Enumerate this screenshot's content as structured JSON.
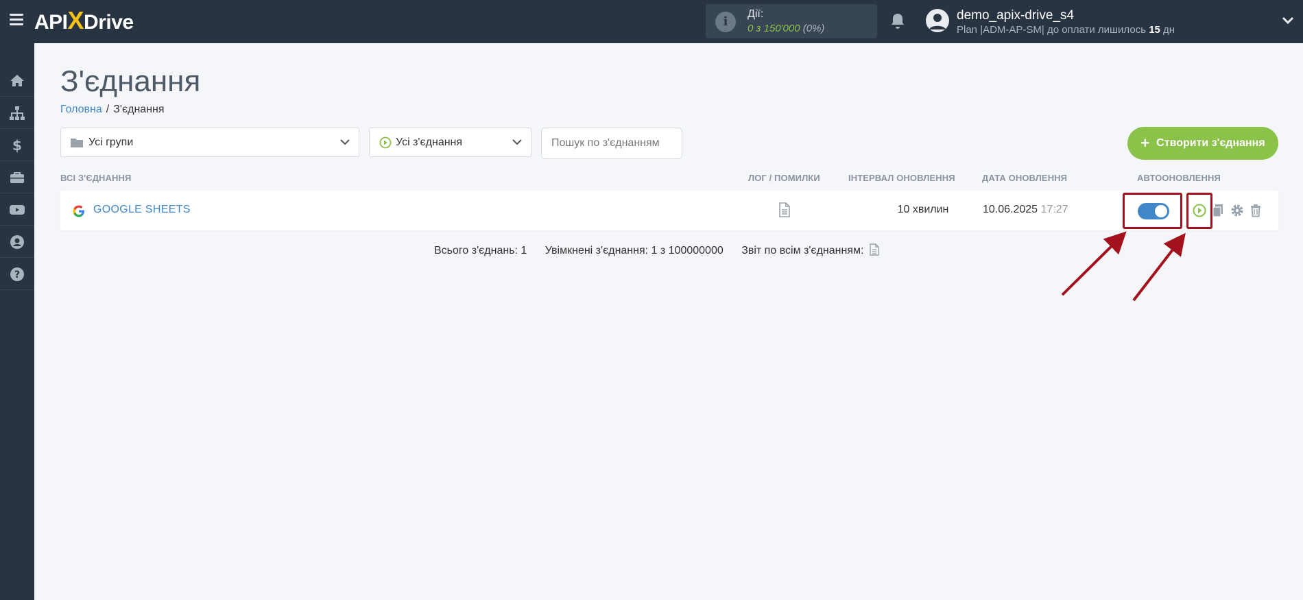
{
  "brand": {
    "logo_pre": "API",
    "logo_x": "X",
    "logo_post": "Drive"
  },
  "actions": {
    "label": "Дії:",
    "value": "0 з 150'000",
    "percent": "(0%)"
  },
  "user": {
    "name": "demo_apix-drive_s4",
    "plan_prefix": "Plan |ADM-AP-SM| до оплати лишилось",
    "days": "15",
    "days_unit": "дн"
  },
  "sidebar": {
    "items": [
      {
        "icon": "home-icon"
      },
      {
        "icon": "sitemap-icon"
      },
      {
        "icon": "dollar-icon"
      },
      {
        "icon": "briefcase-icon"
      },
      {
        "icon": "youtube-icon"
      },
      {
        "icon": "user-circle-icon"
      },
      {
        "icon": "question-icon"
      }
    ]
  },
  "page": {
    "title": "З'єднання",
    "breadcrumb": {
      "home": "Головна",
      "sep": "/",
      "current": "З'єднання"
    }
  },
  "filters": {
    "groups_value": "Усі групи",
    "connections_value": "Усі з'єднання",
    "search_placeholder": "Пошук по з'єднанням"
  },
  "create_button": {
    "label": "Створити з'єднання"
  },
  "table": {
    "headers": {
      "all": "ВСІ З'ЄДНАННЯ",
      "log": "ЛОГ / ПОМИЛКИ",
      "interval": "ІНТЕРВАЛ ОНОВЛЕННЯ",
      "date": "ДАТА ОНОВЛЕННЯ",
      "auto": "АВТООНОВЛЕННЯ"
    },
    "rows": [
      {
        "name": "GOOGLE SHEETS",
        "interval": "10 хвилин",
        "date": "10.06.2025",
        "time": "17:27",
        "autoupdate_on": true
      }
    ]
  },
  "summary": {
    "total": "Всього з'єднань: 1",
    "enabled": "Увімкнені з'єднання: 1 з 100000000",
    "report": "Звіт по всім з'єднанням:"
  },
  "colors": {
    "accent": "#3f87c9",
    "green": "#8bc34a",
    "highlight": "#a3111d",
    "dark": "#283442"
  }
}
